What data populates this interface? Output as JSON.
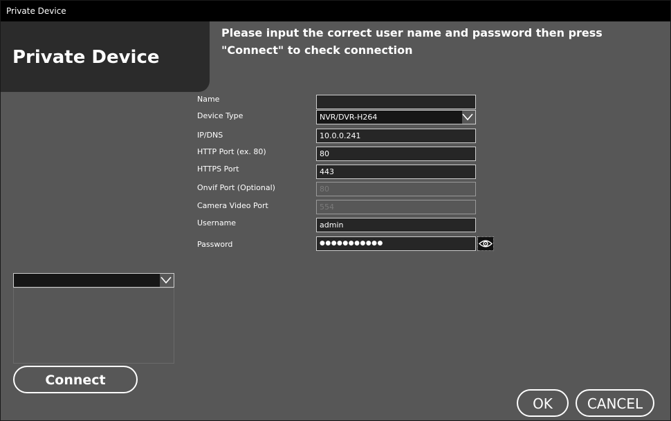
{
  "window": {
    "title": "Private Device"
  },
  "header": {
    "title": "Private Device",
    "instruction": "Please input the correct user name and password then press \"Connect\" to check connection"
  },
  "form": {
    "name": {
      "label": "Name",
      "value": ""
    },
    "device_type": {
      "label": "Device Type",
      "value": "NVR/DVR-H264"
    },
    "ip_dns": {
      "label": "IP/DNS",
      "value": "10.0.0.241"
    },
    "http_port": {
      "label": "HTTP Port (ex. 80)",
      "value": "80"
    },
    "https_port": {
      "label": "HTTPS Port",
      "value": "443"
    },
    "onvif_port": {
      "label": "Onvif Port (Optional)",
      "value": "80"
    },
    "camera_video_port": {
      "label": "Camera Video Port",
      "value": "554"
    },
    "username": {
      "label": "Username",
      "value": "admin"
    },
    "password": {
      "label": "Password",
      "value": "●●●●●●●●●●●"
    }
  },
  "icons": {
    "show_password": "eye-icon",
    "dropdown": "chevron-down-icon"
  },
  "buttons": {
    "connect": "Connect",
    "ok": "OK",
    "cancel": "CANCEL"
  },
  "colors": {
    "background": "#575757",
    "header_panel": "#2b2b2b",
    "titlebar": "#000000",
    "input_bg": "#262626"
  }
}
